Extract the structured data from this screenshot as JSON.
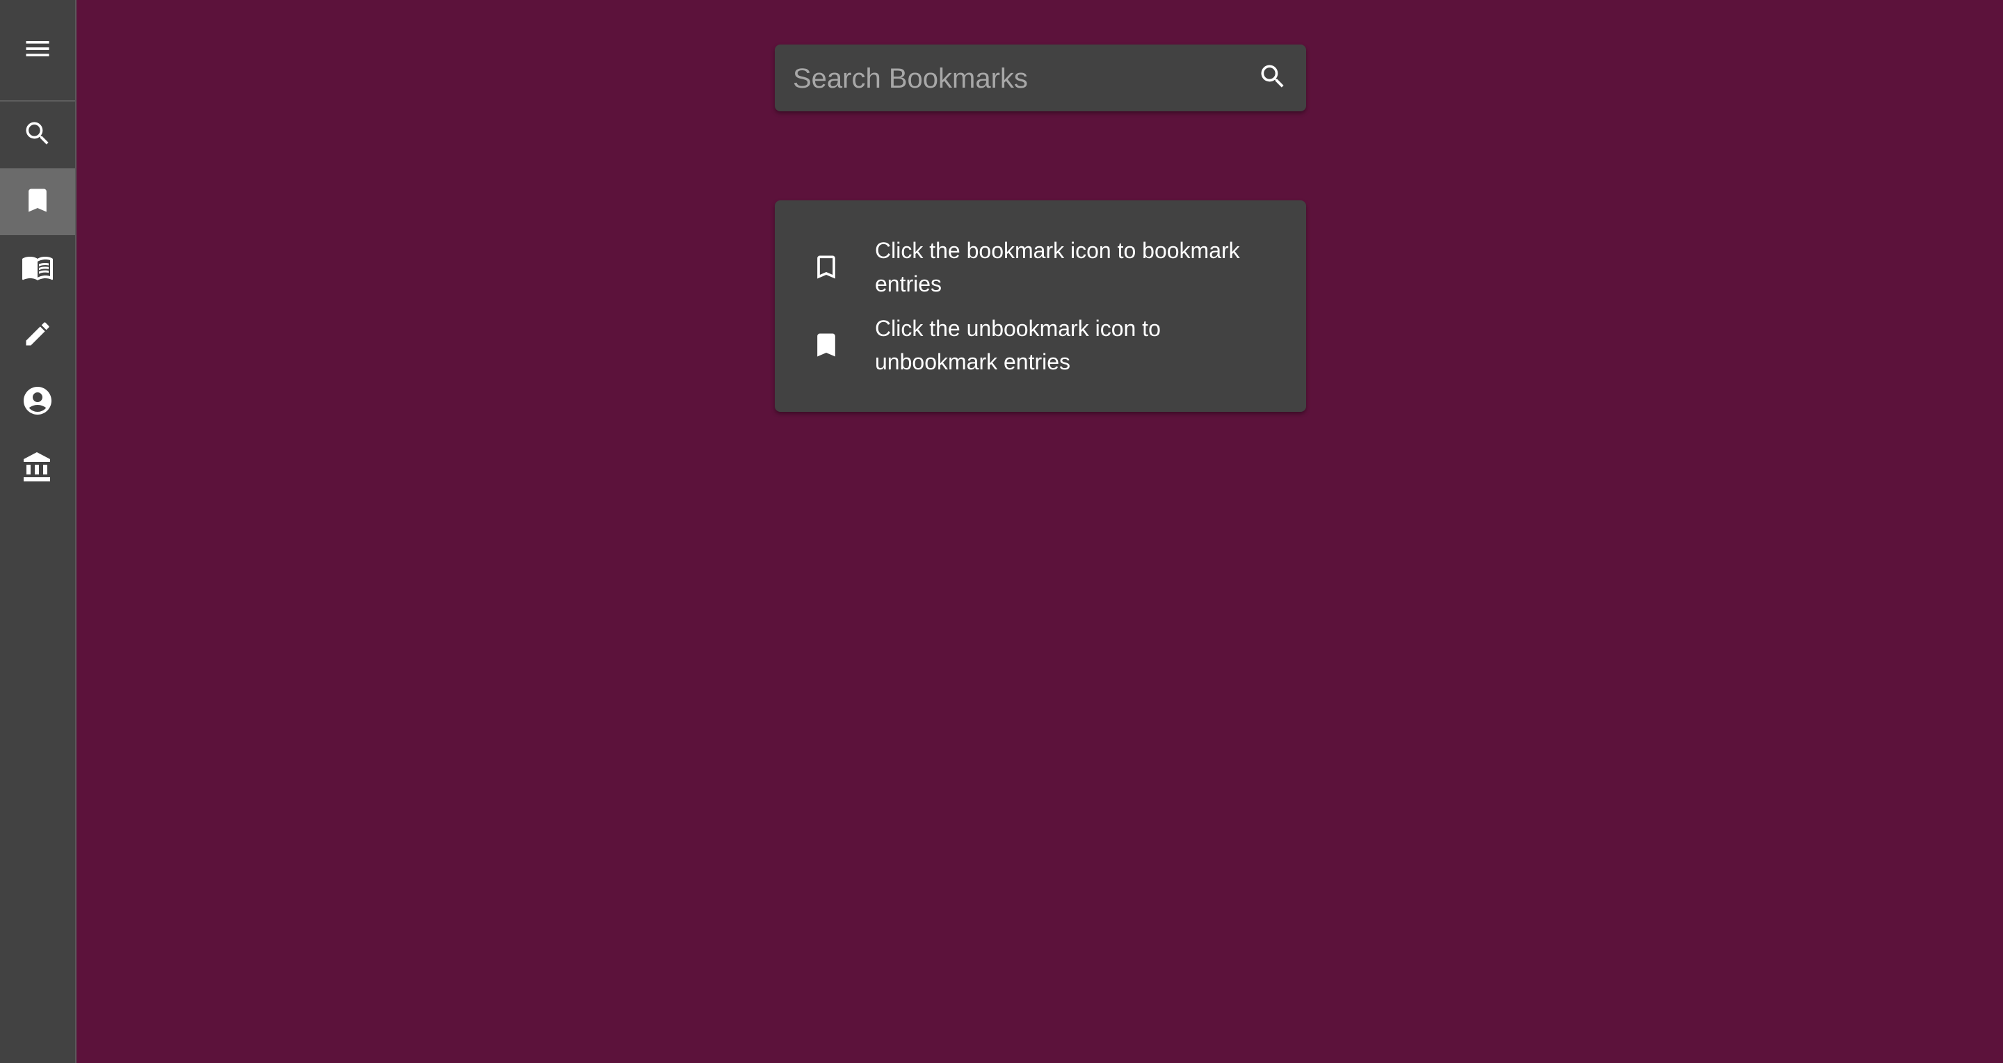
{
  "sidebar": {
    "menu_icon": "menu-icon",
    "items": [
      {
        "id": "search",
        "icon": "search-icon",
        "active": false
      },
      {
        "id": "bookmarks",
        "icon": "bookmark-icon",
        "active": true
      },
      {
        "id": "reader",
        "icon": "menu-book-icon",
        "active": false
      },
      {
        "id": "edit",
        "icon": "pencil-icon",
        "active": false
      },
      {
        "id": "account",
        "icon": "account-circle-icon",
        "active": false
      },
      {
        "id": "institution",
        "icon": "institution-icon",
        "active": false
      }
    ]
  },
  "search": {
    "placeholder": "Search Bookmarks",
    "value": "",
    "button_icon": "search-icon"
  },
  "help": {
    "items": [
      {
        "icon": "bookmark-outline-icon",
        "text": "Click the bookmark icon to bookmark entries"
      },
      {
        "icon": "bookmark-filled-icon",
        "text": "Click the unbookmark icon to unbookmark entries"
      }
    ]
  },
  "colors": {
    "background": "#5c123b",
    "panel": "#424242",
    "sidebar_active": "#6b6b6b",
    "text": "#ffffff",
    "placeholder": "#a8a8a8"
  }
}
